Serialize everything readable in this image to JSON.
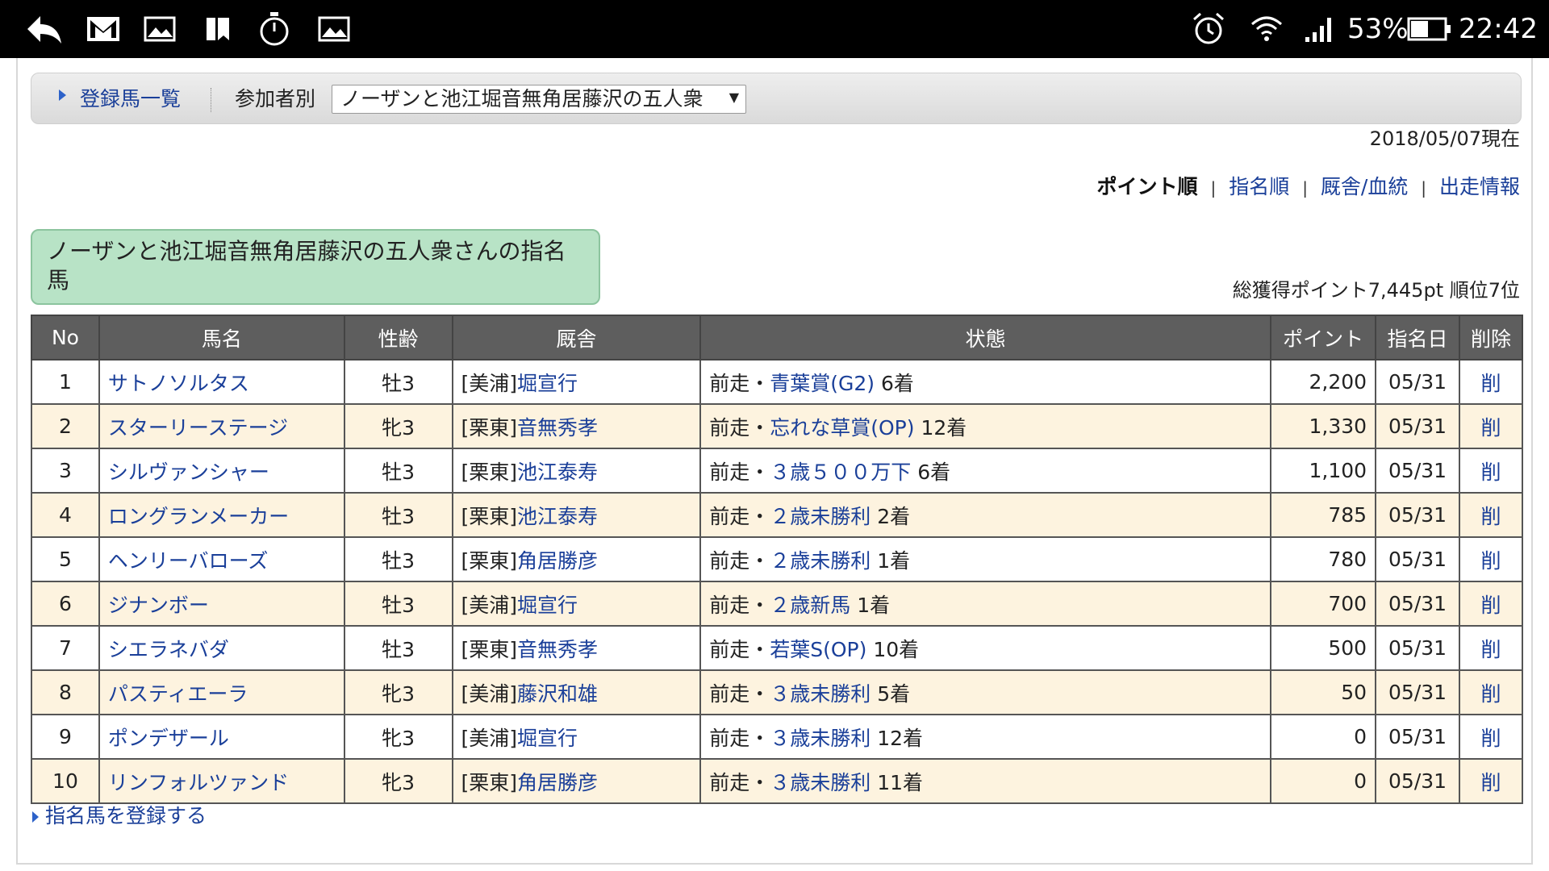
{
  "status_bar": {
    "icons": [
      "back-icon",
      "gmail-icon",
      "image-icon",
      "bookmark-icon",
      "stopwatch-icon",
      "image-icon",
      "alarm-icon",
      "wifi-icon",
      "signal-icon",
      "battery-icon"
    ],
    "battery": "53%",
    "time": "22:42",
    "battery_level": 0.53
  },
  "nav": {
    "registered_link": "登録馬一覧",
    "participant_label": "参加者別",
    "selected_participant": "ノーザンと池江堀音無角居藤沢の五人衆",
    "caret": "▼"
  },
  "as_of": "2018/05/07現在",
  "sort": {
    "current": "ポイント順",
    "options": [
      "指名順",
      "厩舎/血統",
      "出走情報"
    ],
    "separator": "|"
  },
  "title": "ノーザンと池江堀音無角居藤沢の五人衆さんの指名馬",
  "total": "総獲得ポイント7,445pt 順位7位",
  "table": {
    "headers": [
      "No",
      "馬名",
      "性齢",
      "厩舎",
      "状態",
      "ポイント",
      "指名日",
      "削除"
    ],
    "rows": [
      {
        "no": "1",
        "name": "サトノソルタス",
        "sex_age": "牡3",
        "region": "[美浦]",
        "trainer": "堀宣行",
        "prefix": "前走・",
        "race": "青葉賞(G2)",
        "result": "6着",
        "points": "2,200",
        "date": "05/31",
        "del": "削"
      },
      {
        "no": "2",
        "name": "スターリーステージ",
        "sex_age": "牝3",
        "region": "[栗東]",
        "trainer": "音無秀孝",
        "prefix": "前走・",
        "race": "忘れな草賞(OP)",
        "result": "12着",
        "points": "1,330",
        "date": "05/31",
        "del": "削"
      },
      {
        "no": "3",
        "name": "シルヴァンシャー",
        "sex_age": "牡3",
        "region": "[栗東]",
        "trainer": "池江泰寿",
        "prefix": "前走・",
        "race": "３歳５００万下",
        "result": "6着",
        "points": "1,100",
        "date": "05/31",
        "del": "削"
      },
      {
        "no": "4",
        "name": "ロングランメーカー",
        "sex_age": "牡3",
        "region": "[栗東]",
        "trainer": "池江泰寿",
        "prefix": "前走・",
        "race": "２歳未勝利",
        "result": "2着",
        "points": "785",
        "date": "05/31",
        "del": "削"
      },
      {
        "no": "5",
        "name": "ヘンリーバローズ",
        "sex_age": "牡3",
        "region": "[栗東]",
        "trainer": "角居勝彦",
        "prefix": "前走・",
        "race": "２歳未勝利",
        "result": "1着",
        "points": "780",
        "date": "05/31",
        "del": "削"
      },
      {
        "no": "6",
        "name": "ジナンボー",
        "sex_age": "牡3",
        "region": "[美浦]",
        "trainer": "堀宣行",
        "prefix": "前走・",
        "race": "２歳新馬",
        "result": "1着",
        "points": "700",
        "date": "05/31",
        "del": "削"
      },
      {
        "no": "7",
        "name": "シエラネバダ",
        "sex_age": "牡3",
        "region": "[栗東]",
        "trainer": "音無秀孝",
        "prefix": "前走・",
        "race": "若葉S(OP)",
        "result": "10着",
        "points": "500",
        "date": "05/31",
        "del": "削"
      },
      {
        "no": "8",
        "name": "パスティエーラ",
        "sex_age": "牝3",
        "region": "[美浦]",
        "trainer": "藤沢和雄",
        "prefix": "前走・",
        "race": "３歳未勝利",
        "result": "5着",
        "points": "50",
        "date": "05/31",
        "del": "削"
      },
      {
        "no": "9",
        "name": "ポンデザール",
        "sex_age": "牝3",
        "region": "[美浦]",
        "trainer": "堀宣行",
        "prefix": "前走・",
        "race": "３歳未勝利",
        "result": "12着",
        "points": "0",
        "date": "05/31",
        "del": "削"
      },
      {
        "no": "10",
        "name": "リンフォルツァンド",
        "sex_age": "牝3",
        "region": "[栗東]",
        "trainer": "角居勝彦",
        "prefix": "前走・",
        "race": "３歳未勝利",
        "result": "11着",
        "points": "0",
        "date": "05/31",
        "del": "削"
      }
    ]
  },
  "register_link": "指名馬を登録する",
  "colors": {
    "link": "#1a3f99",
    "header_bg": "#5e5e5e",
    "even_row": "#fdf3df",
    "title_bg": "#b8e3c6"
  }
}
